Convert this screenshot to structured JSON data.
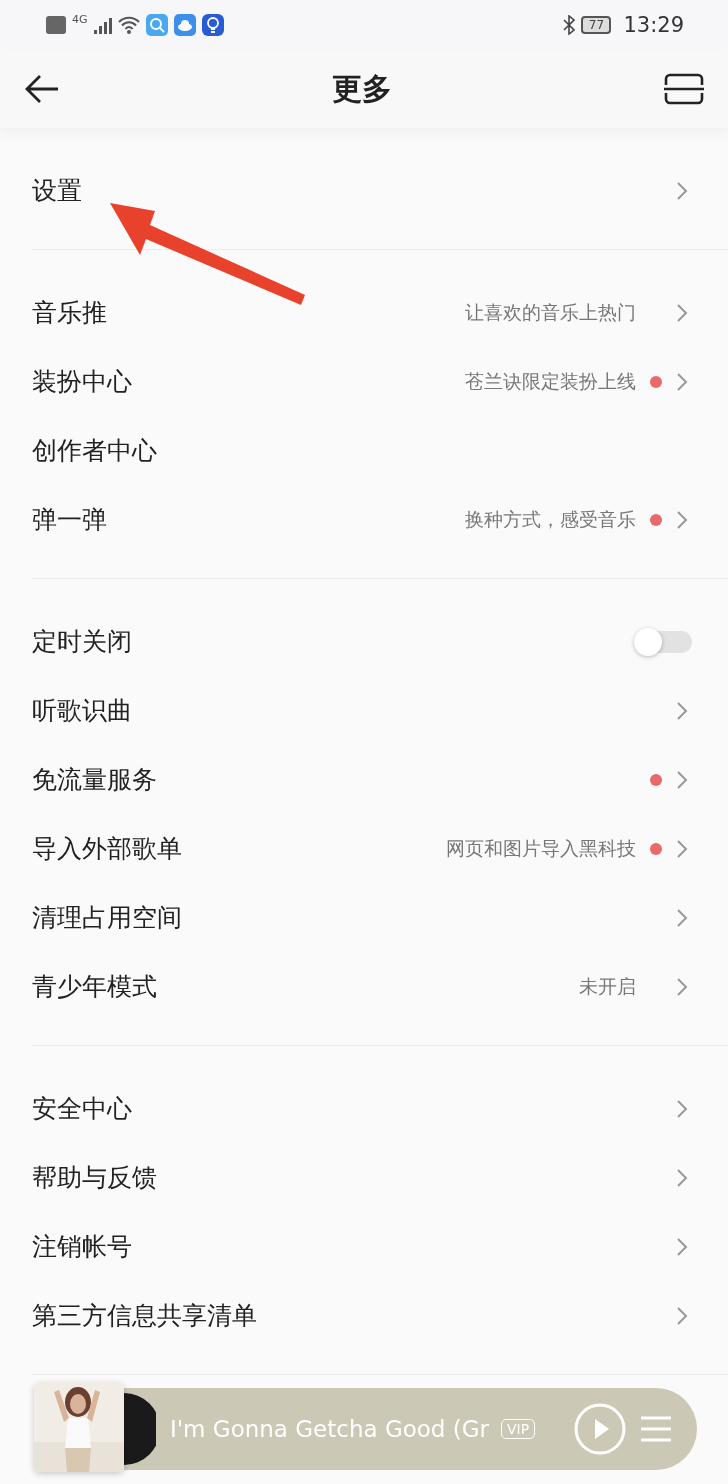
{
  "status_bar": {
    "network": "4G",
    "battery": "77",
    "time": "13:29"
  },
  "header": {
    "title": "更多"
  },
  "sections": [
    {
      "items": [
        {
          "kind": "link",
          "label": "设置",
          "badge": false
        }
      ]
    },
    {
      "items": [
        {
          "kind": "link",
          "label": "音乐推",
          "hint": "让喜欢的音乐上热门",
          "badge": false
        },
        {
          "kind": "link",
          "label": "装扮中心",
          "hint": "苍兰诀限定装扮上线",
          "badge": true
        },
        {
          "kind": "plain",
          "label": "创作者中心",
          "badge": false
        },
        {
          "kind": "link",
          "label": "弹一弹",
          "hint": "换种方式，感受音乐",
          "badge": true
        }
      ]
    },
    {
      "items": [
        {
          "kind": "toggle",
          "label": "定时关闭",
          "on": false,
          "badge": false
        },
        {
          "kind": "link",
          "label": "听歌识曲",
          "badge": false
        },
        {
          "kind": "link",
          "label": "免流量服务",
          "badge": true
        },
        {
          "kind": "link",
          "label": "导入外部歌单",
          "hint": "网页和图片导入黑科技",
          "badge": true
        },
        {
          "kind": "link",
          "label": "清理占用空间",
          "badge": false
        },
        {
          "kind": "link",
          "label": "青少年模式",
          "hint": "未开启",
          "badge": false
        }
      ]
    },
    {
      "items": [
        {
          "kind": "link",
          "label": "安全中心",
          "badge": false
        },
        {
          "kind": "link",
          "label": "帮助与反馈",
          "badge": false
        },
        {
          "kind": "link",
          "label": "注销帐号",
          "badge": false
        },
        {
          "kind": "link",
          "label": "第三方信息共享清单",
          "badge": false
        }
      ]
    }
  ],
  "player": {
    "title": "I'm Gonna Getcha Good (Gr",
    "badge": "VIP"
  },
  "annotation": {
    "kind": "arrow"
  }
}
